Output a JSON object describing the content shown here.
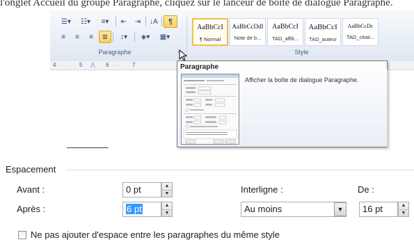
{
  "caption": "l'onglet Accueil du groupe Paragraphe, cliquez sur le lanceur de boîte de dialogue Paragraphe.",
  "ribbon": {
    "paragraph_group_label": "Paragraphe",
    "style_group_label": "Style",
    "styles": [
      {
        "sample": "AaBbCcI",
        "name": "¶ Normal",
        "selected": true
      },
      {
        "sample": "AaBbCcDdI",
        "name": "Note de b...",
        "selected": false
      },
      {
        "sample": "AaBbCcI",
        "name": "TAD_affili...",
        "selected": false
      },
      {
        "sample": "AaBbCcI",
        "name": "TAD_auteur",
        "selected": false
      },
      {
        "sample": "AaBbCcDc",
        "name": "TAD_citati...",
        "selected": false
      }
    ]
  },
  "ruler": {
    "marks": [
      "4",
      "5",
      "6",
      "7"
    ]
  },
  "tooltip": {
    "title": "Paragraphe",
    "description": "Afficher la boîte de dialogue Paragraphe."
  },
  "spacing": {
    "section_label": "Espacement",
    "before_label": "Avant :",
    "before_value": "0 pt",
    "after_label": "Après :",
    "after_value": "6 pt",
    "line_spacing_label": "Interligne :",
    "line_spacing_value": "Au moins",
    "at_label": "De :",
    "at_value": "16 pt",
    "no_space_checkbox_label": "Ne pas ajouter d'espace entre les paragraphes du même style",
    "no_space_checked": false
  },
  "colors": {
    "ribbon_bg": "#dfe7f2",
    "selection": "#3399ff",
    "style_highlight": "#f2be4a"
  }
}
